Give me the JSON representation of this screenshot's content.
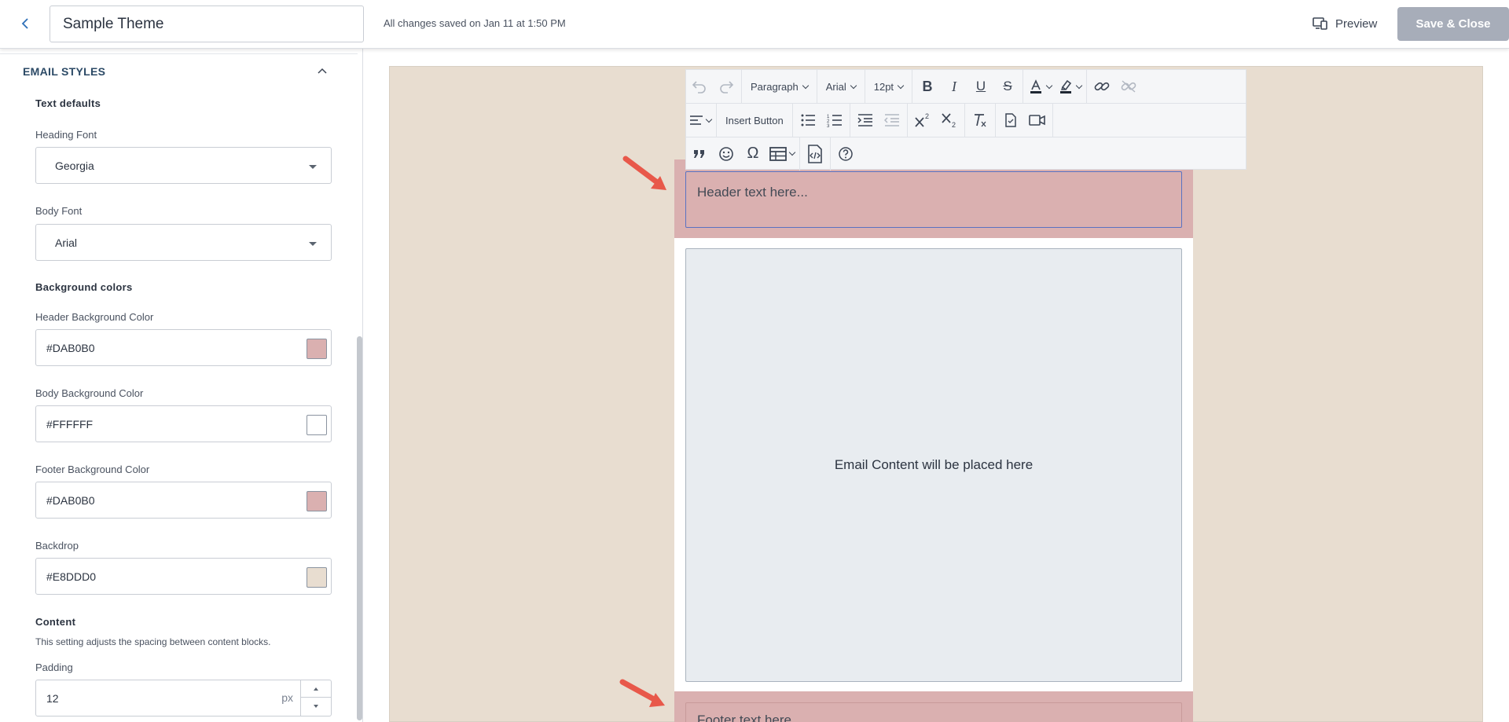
{
  "header": {
    "title_value": "Sample Theme",
    "saved_status": "All changes saved on Jan 11 at 1:50 PM",
    "preview_label": "Preview",
    "save_close_label": "Save & Close"
  },
  "sidebar": {
    "section_title": "EMAIL STYLES",
    "text_defaults": {
      "group_label": "Text defaults",
      "heading_font_label": "Heading Font",
      "heading_font_value": "Georgia",
      "body_font_label": "Body Font",
      "body_font_value": "Arial"
    },
    "background_colors": {
      "group_label": "Background colors",
      "header_label": "Header Background Color",
      "header_value": "#DAB0B0",
      "body_label": "Body Background Color",
      "body_value": "#FFFFFF",
      "footer_label": "Footer Background Color",
      "footer_value": "#DAB0B0",
      "backdrop_label": "Backdrop",
      "backdrop_value": "#E8DDD0"
    },
    "content": {
      "group_label": "Content",
      "help_text": "This setting adjusts the spacing between content blocks.",
      "padding_label": "Padding",
      "padding_value": "12",
      "padding_unit": "px"
    }
  },
  "toolbar": {
    "block_format": "Paragraph",
    "font_family": "Arial",
    "font_size": "12pt",
    "insert_button_label": "Insert Button"
  },
  "email_preview": {
    "header_text": "Header text here...",
    "content_placeholder": "Email Content will be placed here",
    "footer_text": "Footer text here..."
  },
  "colors": {
    "header_bg": "#DAB0B0",
    "body_bg": "#FFFFFF",
    "footer_bg": "#DAB0B0",
    "backdrop": "#E8DDD0",
    "accent": "#2C4A66",
    "arrow": "#E8584A"
  },
  "icons": [
    "back-arrow-icon",
    "preview-devices-icon",
    "chevron-up-icon",
    "undo-icon",
    "redo-icon",
    "bold-icon",
    "italic-icon",
    "underline-icon",
    "strikethrough-icon",
    "text-color-icon",
    "highlight-color-icon",
    "link-icon",
    "unlink-icon",
    "align-left-icon",
    "bullet-list-icon",
    "numbered-list-icon",
    "indent-icon",
    "outdent-icon",
    "superscript-icon",
    "subscript-icon",
    "clear-format-icon",
    "insert-document-icon",
    "insert-video-icon",
    "blockquote-icon",
    "emoji-icon",
    "special-character-icon",
    "table-icon",
    "source-code-icon",
    "help-icon",
    "annotation-arrow-icon"
  ]
}
